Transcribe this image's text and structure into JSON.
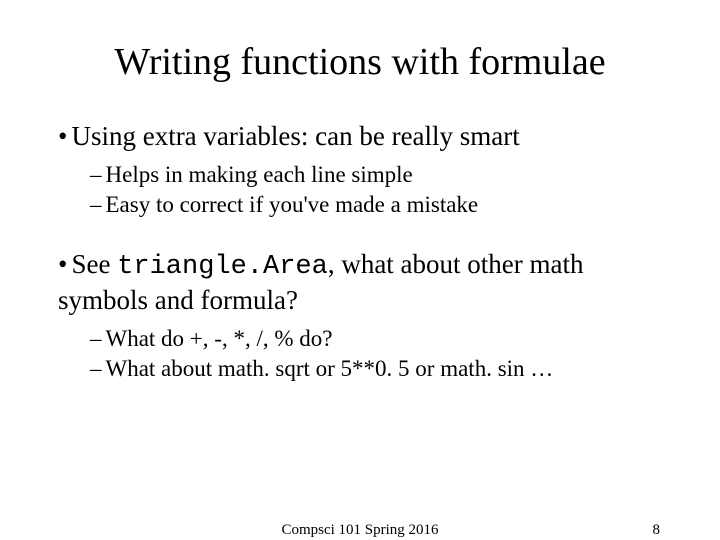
{
  "title": "Writing functions with formulae",
  "bullets": [
    {
      "text": "Using extra variables: can be really smart",
      "subs": [
        "Helps in making each line simple",
        "Easy to correct if you've made a mistake"
      ]
    },
    {
      "prefix": "See ",
      "code": "triangle.Area",
      "suffix": ", what about other math symbols and formula?",
      "subs": [
        "What do +, -, *, /, % do?",
        "What about math. sqrt or 5**0. 5 or math. sin …"
      ]
    }
  ],
  "footer": {
    "center": "Compsci 101 Spring 2016",
    "page": "8"
  }
}
